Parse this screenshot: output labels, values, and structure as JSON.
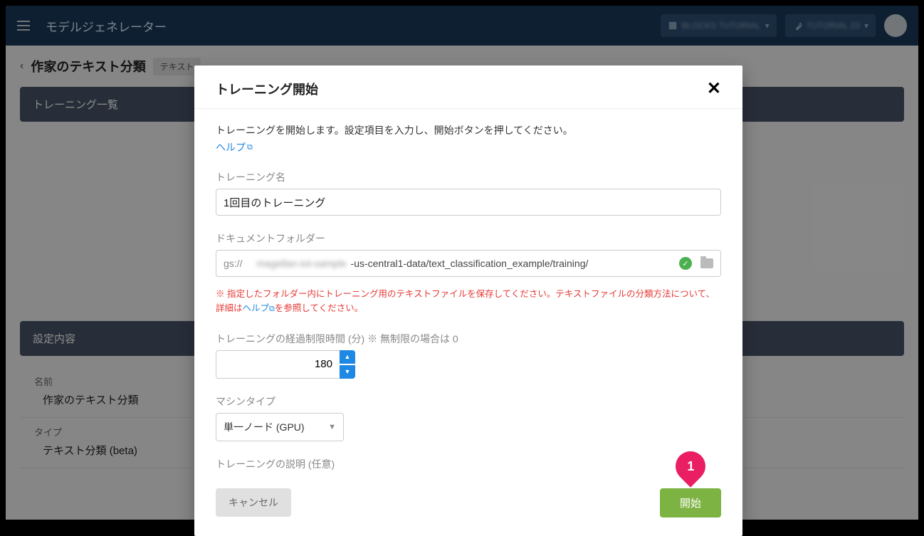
{
  "topbar": {
    "title": "モデルジェネレーター",
    "project_label": "BLOCKS TUTORIAL",
    "env_label": "TUTORIAL 23"
  },
  "page": {
    "breadcrumb_title": "作家のテキスト分類",
    "tag": "テキスト",
    "training_list_header": "トレーニング一覧",
    "settings_header": "設定内容",
    "settings": {
      "name_label": "名前",
      "name_value": "作家のテキスト分類",
      "type_label": "タイプ",
      "type_value": "テキスト分類 (beta)"
    }
  },
  "modal": {
    "title": "トレーニング開始",
    "description": "トレーニングを開始します。設定項目を入力し、開始ボタンを押してください。",
    "help_text": "ヘルプ",
    "training_name_label": "トレーニング名",
    "training_name_value": "1回目のトレーニング",
    "doc_folder_label": "ドキュメントフォルダー",
    "gs_prefix": "gs://",
    "folder_blurred": "magellan-iot-sample",
    "folder_path": "-us-central1-data/text_classification_example/training/",
    "warning_prefix": "※ 指定したフォルダー内にトレーニング用のテキストファイルを保存してください。テキストファイルの分類方法について、詳細は",
    "warning_link": "ヘルプ",
    "warning_suffix": "を参照してください。",
    "time_limit_label": "トレーニングの経過制限時間 (分) ※ 無制限の場合は 0",
    "time_limit_value": "180",
    "machine_type_label": "マシンタイプ",
    "machine_type_value": "単一ノード (GPU)",
    "desc_optional_label": "トレーニングの説明 (任意)",
    "cancel_label": "キャンセル",
    "start_label": "開始",
    "callout_number": "1"
  }
}
